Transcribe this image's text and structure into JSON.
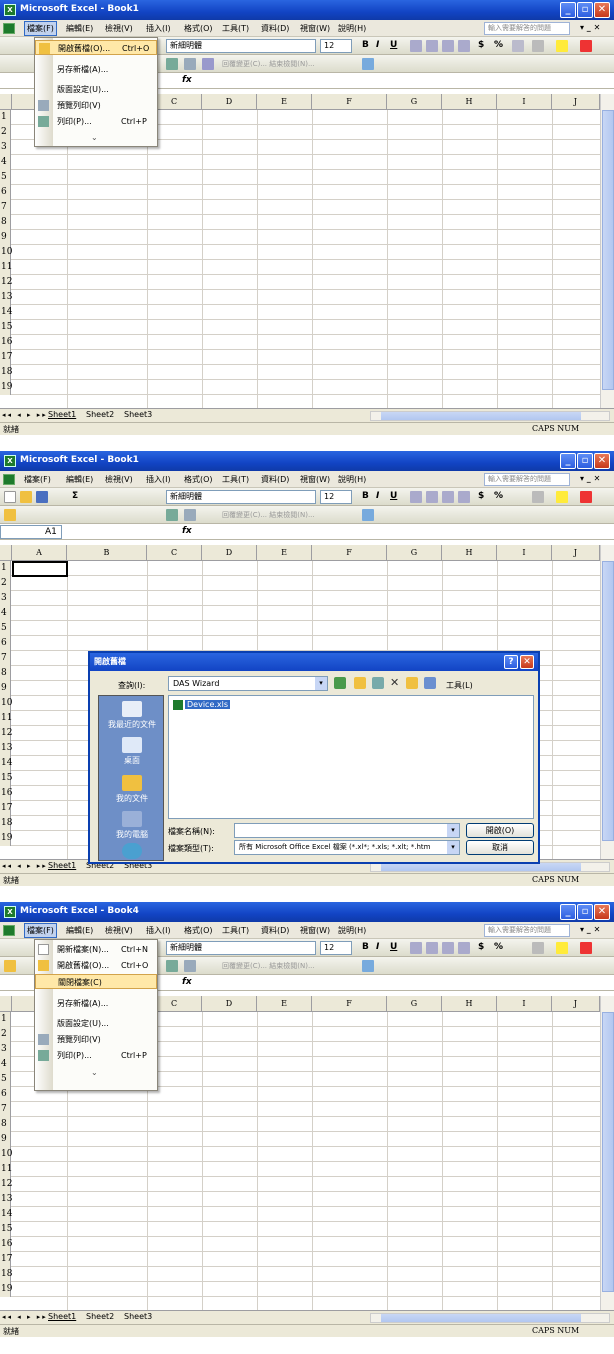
{
  "app": {
    "title_book1": "Microsoft Excel - Book1",
    "title_book4": "Microsoft Excel - Book4"
  },
  "menus": [
    "檔案(F)",
    "編輯(E)",
    "檢視(V)",
    "插入(I)",
    "格式(O)",
    "工具(T)",
    "資料(D)",
    "視窗(W)",
    "說明(H)"
  ],
  "help_placeholder": "輸入需要解答的問題",
  "font_name": "新細明體",
  "font_size": "12",
  "toolbar2_text": "回覆變更(C)... 結束檢閱(N)...",
  "fx": "fx",
  "namebox": "A1",
  "columns": [
    "A",
    "B",
    "C",
    "D",
    "E",
    "F",
    "G",
    "H",
    "I",
    "J"
  ],
  "rows": [
    "1",
    "2",
    "3",
    "4",
    "5",
    "6",
    "7",
    "8",
    "9",
    "10",
    "11",
    "12",
    "13",
    "14",
    "15",
    "16",
    "17",
    "18",
    "19"
  ],
  "sheets": [
    "Sheet1",
    "Sheet2",
    "Sheet3"
  ],
  "status": {
    "ready": "就緒",
    "caps": "CAPS NUM"
  },
  "menu1": [
    {
      "label": "開啟舊檔(O)...",
      "shortcut": "Ctrl+O",
      "icon": "open-folder-icon",
      "highlight": true
    },
    {
      "label": "另存新檔(A)...",
      "shortcut": "",
      "icon": "",
      "highlight": false
    },
    {
      "label": "版面設定(U)...",
      "shortcut": "",
      "icon": "",
      "highlight": false
    },
    {
      "label": "預覽列印(V)",
      "shortcut": "",
      "icon": "print-preview-icon",
      "highlight": false
    },
    {
      "label": "列印(P)...",
      "shortcut": "Ctrl+P",
      "icon": "print-icon",
      "highlight": false
    }
  ],
  "menu3": [
    {
      "label": "開新檔案(N)...",
      "shortcut": "Ctrl+N",
      "icon": "new-file-icon",
      "highlight": false
    },
    {
      "label": "開啟舊檔(O)...",
      "shortcut": "Ctrl+O",
      "icon": "open-folder-icon",
      "highlight": false
    },
    {
      "label": "關閉檔案(C)",
      "shortcut": "",
      "icon": "",
      "highlight": true
    },
    {
      "label": "另存新檔(A)...",
      "shortcut": "",
      "icon": "",
      "highlight": false
    },
    {
      "label": "版面設定(U)...",
      "shortcut": "",
      "icon": "",
      "highlight": false
    },
    {
      "label": "預覽列印(V)",
      "shortcut": "",
      "icon": "print-preview-icon",
      "highlight": false
    },
    {
      "label": "列印(P)...",
      "shortcut": "Ctrl+P",
      "icon": "print-icon",
      "highlight": false
    }
  ],
  "dialog": {
    "title": "開啟舊檔",
    "lookin_label": "查詢(I):",
    "lookin_value": "DAS Wizard",
    "tools_label": "工具(L)",
    "file": "Device.xls",
    "places": [
      "我最近的文件",
      "桌面",
      "我的文件",
      "我的電腦",
      ""
    ],
    "filename_label": "檔案名稱(N):",
    "filename_value": "",
    "filetype_label": "檔案類型(T):",
    "filetype_value": "所有 Microsoft Office Excel 檔案 (*.xl*; *.xls; *.xlt; *.htm",
    "open_btn": "開啟(O)",
    "cancel_btn": "取消"
  }
}
